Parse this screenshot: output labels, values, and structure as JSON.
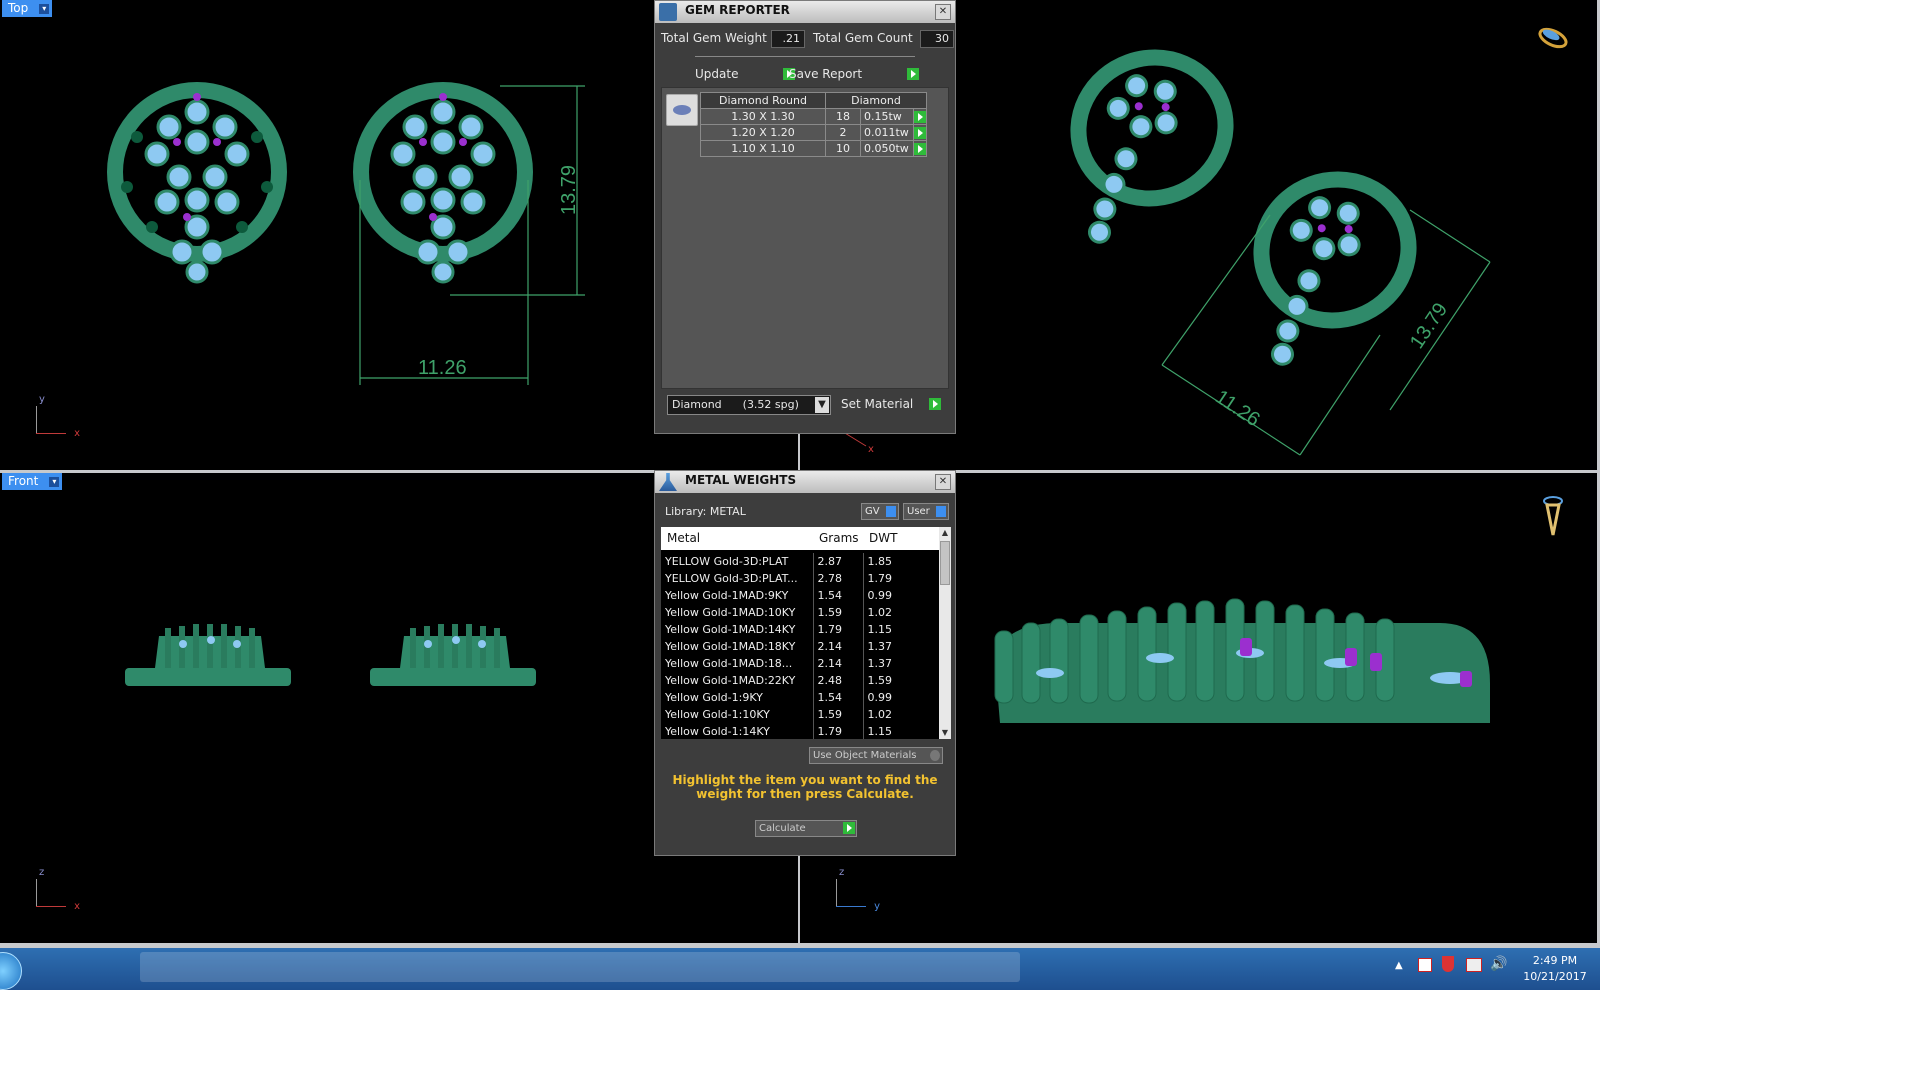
{
  "viewports": {
    "top": {
      "label": "Top",
      "axis_v": "y",
      "axis_h": "x",
      "dim_height": "13.79",
      "dim_width": "11.26"
    },
    "perspective": {
      "dim_height": "13.79",
      "dim_width": "11.26",
      "axis_h": "x"
    },
    "front": {
      "label": "Front",
      "axis_v": "z",
      "axis_h": "x"
    },
    "right": {
      "axis_v": "z",
      "axis_h": "y"
    }
  },
  "gem_reporter": {
    "title": "GEM REPORTER",
    "total_weight_label": "Total Gem Weight",
    "total_weight_value": ".21",
    "total_count_label": "Total Gem Count",
    "total_count_value": "30",
    "update_label": "Update",
    "save_report_label": "Save Report",
    "table_headers": [
      "Diamond Round",
      "Diamond"
    ],
    "rows": [
      {
        "size": "1.30 X 1.30",
        "count": "18",
        "weight": "0.15tw"
      },
      {
        "size": "1.20 X 1.20",
        "count": "2",
        "weight": "0.011tw"
      },
      {
        "size": "1.10 X 1.10",
        "count": "10",
        "weight": "0.050tw"
      }
    ],
    "material_select": "Diamond      (3.52 spg)",
    "set_material_label": "Set Material"
  },
  "metal_weights": {
    "title": "METAL WEIGHTS",
    "library_label": "Library: METAL",
    "gv_label": "GV",
    "user_label": "User",
    "columns": [
      "Metal",
      "Grams",
      "DWT"
    ],
    "rows": [
      {
        "metal": "YELLOW Gold-3D:PLAT",
        "grams": "2.87",
        "dwt": "1.85"
      },
      {
        "metal": "YELLOW Gold-3D:PLAT...",
        "grams": "2.78",
        "dwt": "1.79"
      },
      {
        "metal": "Yellow Gold-1MAD:9KY",
        "grams": "1.54",
        "dwt": "0.99"
      },
      {
        "metal": "Yellow Gold-1MAD:10KY",
        "grams": "1.59",
        "dwt": "1.02"
      },
      {
        "metal": "Yellow Gold-1MAD:14KY",
        "grams": "1.79",
        "dwt": "1.15"
      },
      {
        "metal": "Yellow Gold-1MAD:18KY",
        "grams": "2.14",
        "dwt": "1.37"
      },
      {
        "metal": "Yellow Gold-1MAD:18...",
        "grams": "2.14",
        "dwt": "1.37"
      },
      {
        "metal": "Yellow Gold-1MAD:22KY",
        "grams": "2.48",
        "dwt": "1.59"
      },
      {
        "metal": "Yellow Gold-1:9KY",
        "grams": "1.54",
        "dwt": "0.99"
      },
      {
        "metal": "Yellow Gold-1:10KY",
        "grams": "1.59",
        "dwt": "1.02"
      },
      {
        "metal": "Yellow Gold-1:14KY",
        "grams": "1.79",
        "dwt": "1.15"
      }
    ],
    "use_object_materials_label": "Use Object Materials",
    "instruction": "Highlight the item you want to find the weight for then press Calculate.",
    "calculate_label": "Calculate"
  },
  "taskbar": {
    "time": "2:49 PM",
    "date": "10/21/2017"
  },
  "colors": {
    "metal": "#2f8a6a",
    "gem": "#8ec9f2",
    "accent_gem": "#9b2fcf",
    "dimension": "#3fa26a",
    "viewport_label": "#3d8ff0"
  }
}
